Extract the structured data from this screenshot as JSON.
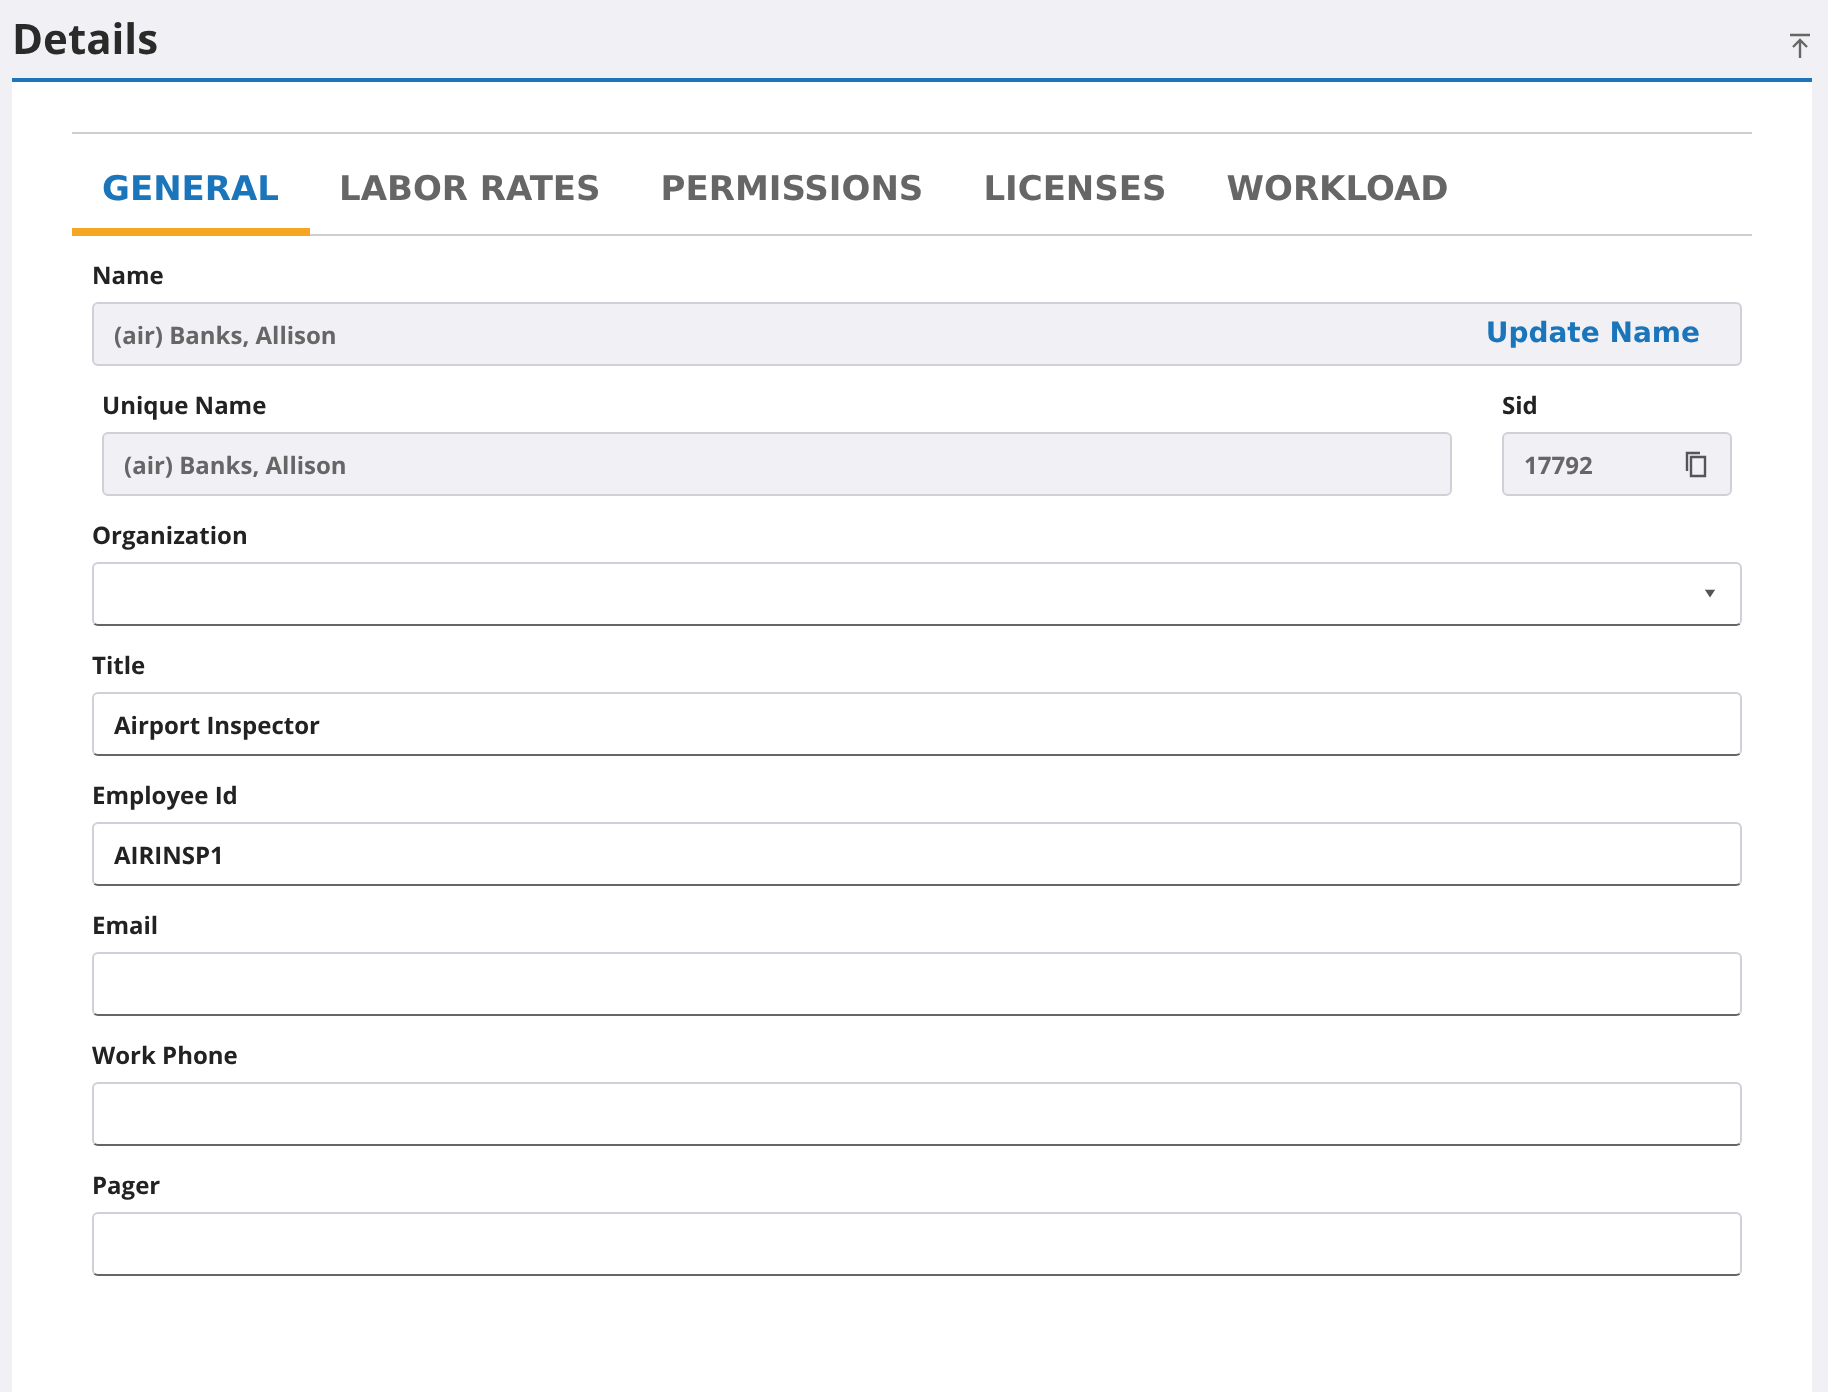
{
  "header": {
    "title": "Details"
  },
  "tabs": [
    {
      "label": "GENERAL",
      "selected": true
    },
    {
      "label": "LABOR RATES",
      "selected": false
    },
    {
      "label": "PERMISSIONS",
      "selected": false
    },
    {
      "label": "LICENSES",
      "selected": false
    },
    {
      "label": "WORKLOAD",
      "selected": false
    }
  ],
  "rows": [
    {
      "kind": "action",
      "label": "Name",
      "value": "(air) Banks, Allison",
      "readonly": true,
      "action": "Update Name"
    },
    {
      "kind": "pair",
      "items": [
        {
          "kind": "text",
          "label": "Unique Name",
          "value": "(air) Banks, Allison",
          "readonly": true
        },
        {
          "kind": "copy",
          "label": "Sid",
          "value": "17792",
          "readonly": true
        }
      ]
    },
    {
      "kind": "select",
      "label": "Organization",
      "readonly": false
    },
    {
      "kind": "text",
      "label": "Title",
      "value": "Airport Inspector",
      "readonly": false
    },
    {
      "kind": "text",
      "label": "Employee Id",
      "value": "AIRINSP1",
      "readonly": false
    },
    {
      "kind": "text",
      "label": "Email",
      "readonly": false
    },
    {
      "kind": "text",
      "label": "Work Phone",
      "readonly": false
    },
    {
      "kind": "text",
      "label": "Pager",
      "readonly": false
    }
  ]
}
